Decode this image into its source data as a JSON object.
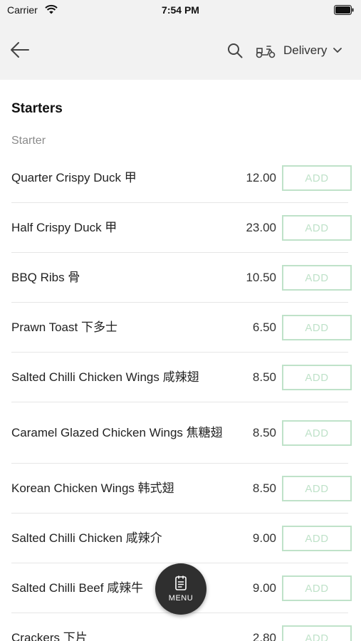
{
  "status_bar": {
    "carrier": "Carrier",
    "time": "7:54 PM"
  },
  "header": {
    "delivery_label": "Delivery",
    "icons": [
      "back-icon",
      "search-icon",
      "scooter-icon",
      "chevron-down-icon"
    ]
  },
  "menu": {
    "section_title": "Starters",
    "category_title": "Starter",
    "add_label": "ADD",
    "items": [
      {
        "name": "Quarter Crispy Duck 甲",
        "price": "12.00"
      },
      {
        "name": "Half Crispy Duck 甲",
        "price": "23.00"
      },
      {
        "name": "BBQ Ribs 骨",
        "price": "10.50"
      },
      {
        "name": "Prawn Toast 下多士",
        "price": "6.50"
      },
      {
        "name": "Salted Chilli Chicken Wings 咸辣翅",
        "price": "8.50"
      },
      {
        "name": "Caramel Glazed Chicken Wings 焦糖翅",
        "price": "8.50"
      },
      {
        "name": "Korean Chicken Wings 韩式翅",
        "price": "8.50"
      },
      {
        "name": "Salted Chilli Chicken 咸辣介",
        "price": "9.00"
      },
      {
        "name": "Salted Chilli Beef 咸辣牛",
        "price": "9.00"
      },
      {
        "name": "Crackers 下片",
        "price": "2.80"
      }
    ]
  },
  "fab": {
    "label": "MENU",
    "icon": "menu-icon"
  },
  "colors": {
    "header_bg": "#f2f2f2",
    "add_button": "#bfe2c9",
    "fab_bg": "#2f2f2f"
  }
}
